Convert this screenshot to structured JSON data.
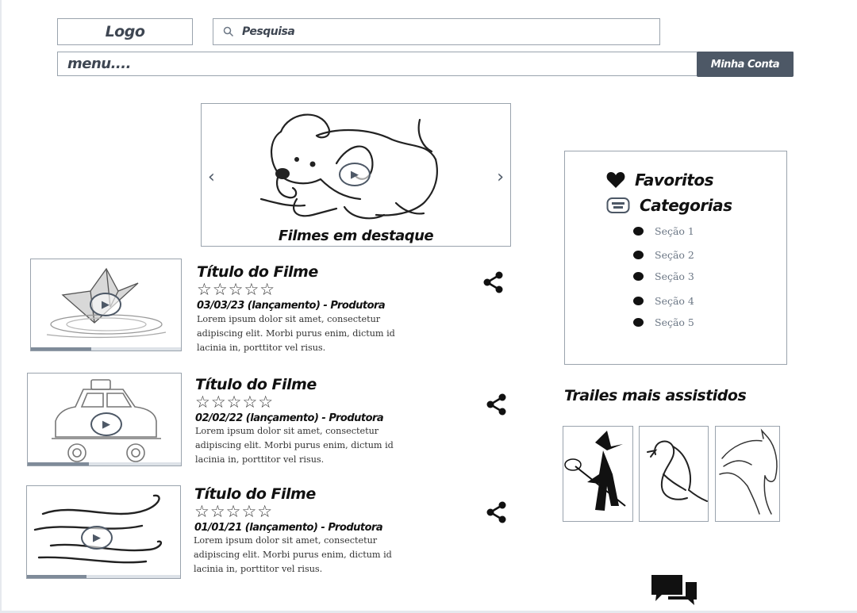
{
  "header": {
    "logo": "Logo",
    "search_placeholder": "Pesquisa",
    "menu": "menu....",
    "account_button": "Minha Conta"
  },
  "carousel": {
    "caption": "Filmes em destaque",
    "prev_icon": "chevron-left-icon",
    "next_icon": "chevron-right-icon"
  },
  "movies": [
    {
      "title": "Título do Filme",
      "stars": "☆☆☆☆☆",
      "meta": "03/03/23 (lançamento) - Produtora",
      "desc": "Lorem ipsum dolor sit amet, consectetur adipiscing elit. Morbi purus enim, dictum id lacinia in, porttitor vel risus.",
      "progress": 0.4
    },
    {
      "title": "Título do Filme",
      "stars": "☆☆☆☆☆",
      "meta": "02/02/22 (lançamento) - Produtora",
      "desc": "Lorem ipsum dolor sit amet, consectetur adipiscing elit. Morbi purus enim, dictum id lacinia in, porttitor vel risus.",
      "progress": 0.4
    },
    {
      "title": "Título do Filme",
      "stars": "☆☆☆☆☆",
      "meta": "01/01/21 (lançamento) - Produtora",
      "desc": "Lorem ipsum dolor sit amet, consectetur adipiscing elit. Morbi purus enim, dictum id lacinia in, porttitor vel risus.",
      "progress": 0.39
    }
  ],
  "sidebar": {
    "favorites": "Favoritos",
    "categories": "Categorias",
    "sections": [
      "Seção 1",
      "Seção 2",
      "Seção 3",
      "Seção 4",
      "Seção 5"
    ]
  },
  "trailers": {
    "title": "Trailes mais assistidos"
  },
  "colors": {
    "accent_button": "#4d5866",
    "border": "#9aa3ad",
    "section_link": "#6c7785"
  }
}
